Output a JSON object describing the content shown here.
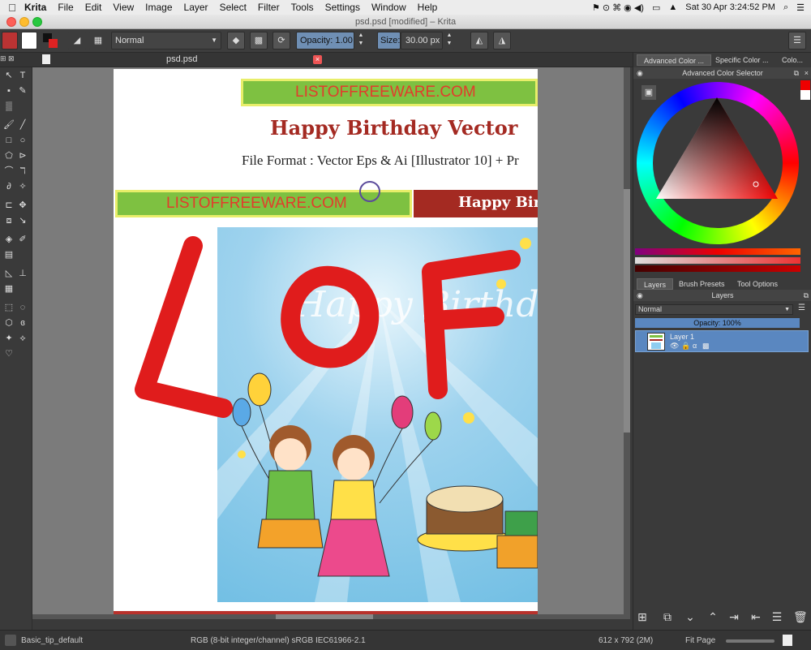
{
  "menubar": {
    "app_name": "Krita",
    "items": [
      "File",
      "Edit",
      "View",
      "Image",
      "Layer",
      "Select",
      "Filter",
      "Tools",
      "Settings",
      "Window",
      "Help"
    ],
    "clock": "Sat 30 Apr  3:24:52 PM"
  },
  "window": {
    "title": "psd.psd [modified] – Krita"
  },
  "toolbar": {
    "blend_mode": "Normal",
    "opacity_label": "Opacity:  1.00",
    "size_label": "Size:",
    "size_value": "30.00 px"
  },
  "document_tab": {
    "name": "psd.psd"
  },
  "canvas_content": {
    "banner_top": "LISTOFFREEWARE.COM",
    "title": "Happy Birthday Vector",
    "subtitle": "File Format : Vector Eps & Ai [Illustrator 10] + Pr",
    "banner_left": "LISTOFFREEWARE.COM",
    "banner_right": "Happy Birt",
    "card_script": "Happy Birthday"
  },
  "right_panel": {
    "tabs": [
      "Advanced Color ...",
      "Specific Color ...",
      "Colo..."
    ],
    "color_selector_title": "Advanced Color Selector",
    "layer_tabs": [
      "Layers",
      "Brush Presets",
      "Tool Options"
    ],
    "layers_title": "Layers",
    "layer_blend_mode": "Normal",
    "layer_opacity": "Opacity:  100%",
    "layers": [
      {
        "name": "Layer 1"
      }
    ]
  },
  "statusbar": {
    "brush": "Basic_tip_default",
    "color_space": "RGB (8-bit integer/channel)  sRGB IEC61966-2.1",
    "dimensions": "612 x 792 (2M)",
    "zoom_mode": "Fit Page"
  },
  "colors": {
    "foreground": "#e8271d",
    "background": "#ffffff",
    "accent": "#5a87c0",
    "stroke_red": "#e01c1c"
  }
}
